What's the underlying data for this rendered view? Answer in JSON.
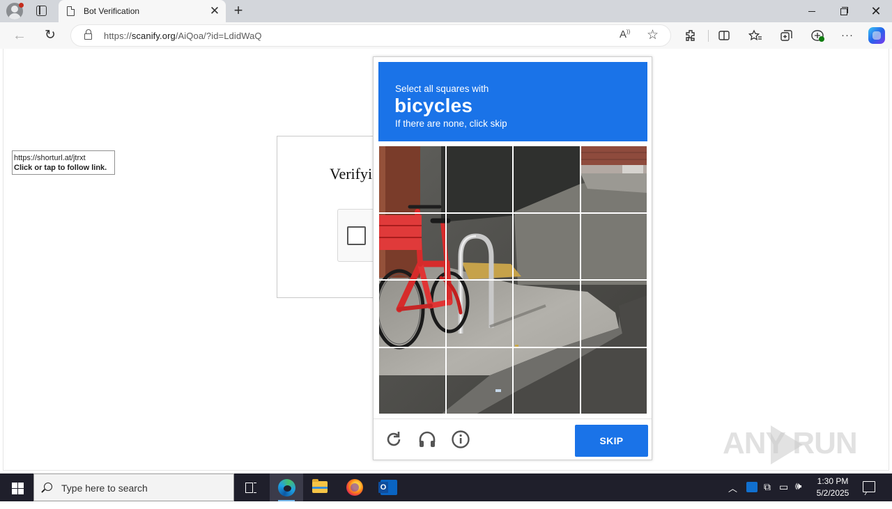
{
  "browser": {
    "tab_title": "Bot Verification",
    "url_prefix": "https://",
    "url_host": "scanify.org",
    "url_path": "/AiQoa/?id=LdidWaQ",
    "tab_close_glyph": "✕",
    "new_tab_glyph": "+",
    "window_close_glyph": "✕"
  },
  "page": {
    "link_tooltip": {
      "url": "https://shorturl.at/jtrxt",
      "action": "Click or tap to follow link."
    },
    "verify_title": "Verifyi",
    "checkbox_checked": false
  },
  "captcha": {
    "instruction": "Select all squares with",
    "target": "bicycles",
    "hint": "If there are none, click skip",
    "grid_rows": 4,
    "grid_cols": 4,
    "selected_cells": [],
    "skip_label": "SKIP",
    "accent_color": "#1a73e8"
  },
  "watermark": "ANY RUN",
  "taskbar": {
    "search_placeholder": "Type here to search",
    "time": "1:30 PM",
    "date": "5/2/2025",
    "apps": [
      "task-view",
      "microsoft-edge",
      "file-explorer",
      "firefox",
      "outlook"
    ]
  }
}
